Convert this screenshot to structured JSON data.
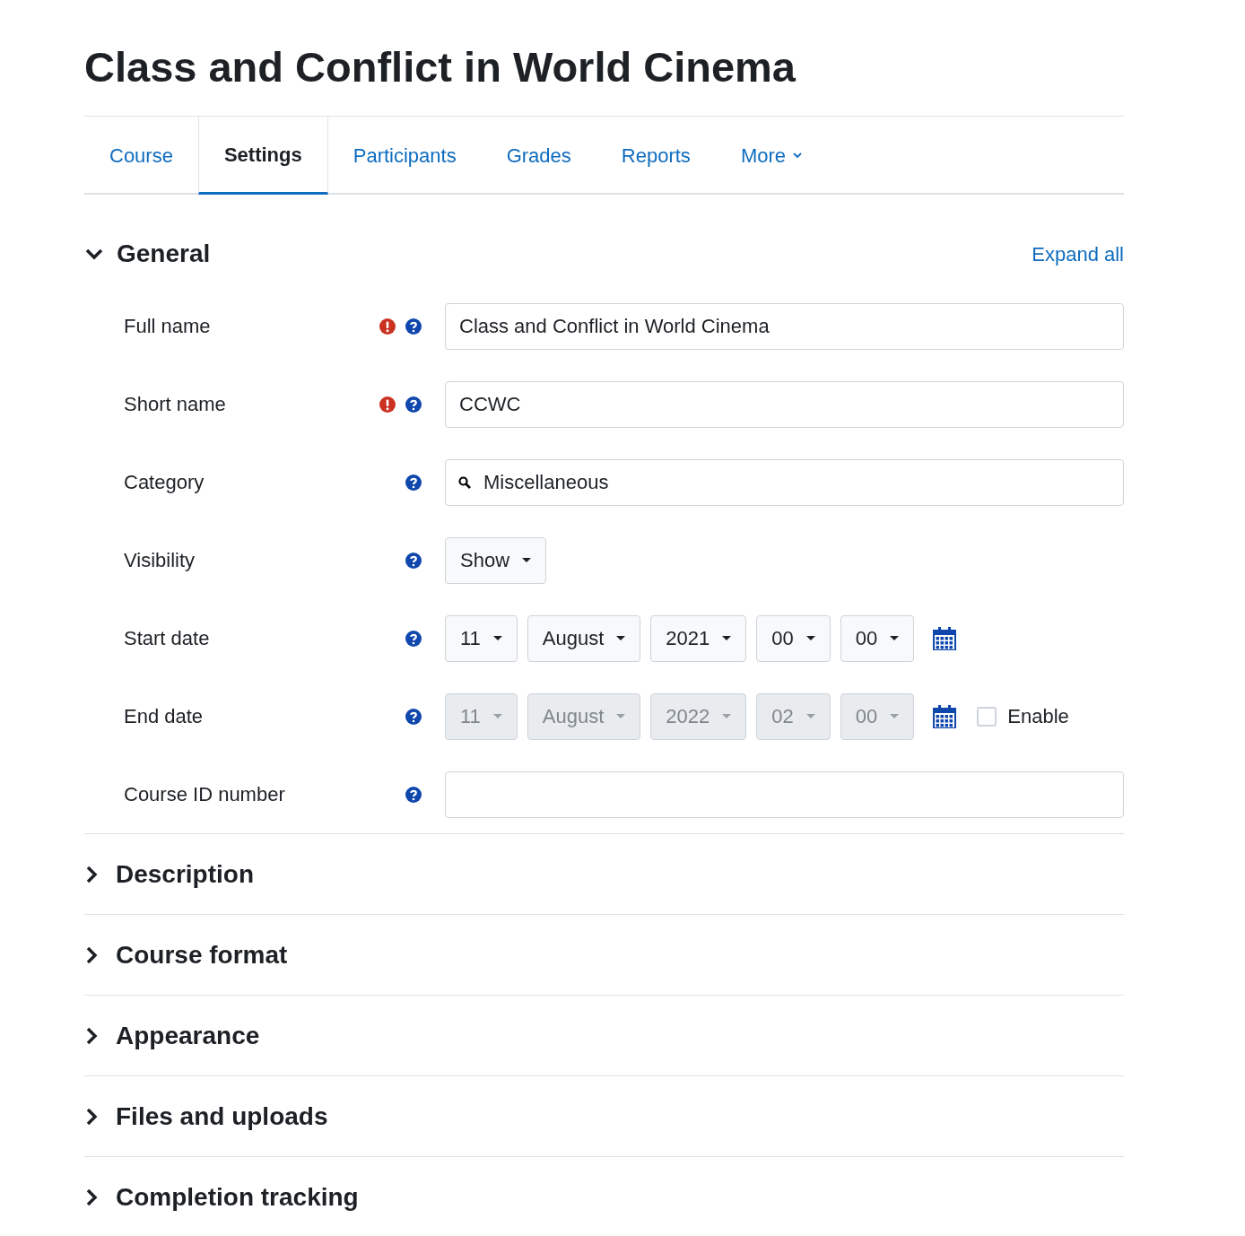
{
  "page_title": "Class and Conflict in World Cinema",
  "tabs": [
    {
      "label": "Course",
      "selected": false,
      "dropdown": false
    },
    {
      "label": "Settings",
      "selected": true,
      "dropdown": false
    },
    {
      "label": "Participants",
      "selected": false,
      "dropdown": false
    },
    {
      "label": "Grades",
      "selected": false,
      "dropdown": false
    },
    {
      "label": "Reports",
      "selected": false,
      "dropdown": false
    },
    {
      "label": "More",
      "selected": false,
      "dropdown": true
    }
  ],
  "general": {
    "title": "General",
    "expanded": true,
    "expand_all": "Expand all",
    "fields": [
      {
        "kind": "text",
        "label": "Full name",
        "required": true,
        "value": "Class and Conflict in World Cinema"
      },
      {
        "kind": "text",
        "label": "Short name",
        "required": true,
        "value": "CCWC"
      },
      {
        "kind": "autocomplete",
        "label": "Category",
        "required": false,
        "value": "Miscellaneous"
      },
      {
        "kind": "select",
        "label": "Visibility",
        "required": false,
        "value": "Show"
      },
      {
        "kind": "date",
        "label": "Start date",
        "required": false,
        "disabled": false,
        "selects": [
          "11",
          "August",
          "2021",
          "00",
          "00"
        ]
      },
      {
        "kind": "date",
        "label": "End date",
        "required": false,
        "disabled": true,
        "selects": [
          "11",
          "August",
          "2022",
          "02",
          "00"
        ],
        "enable": {
          "label": "Enable",
          "checked": false
        }
      },
      {
        "kind": "text",
        "label": "Course ID number",
        "required": false
      }
    ]
  },
  "sections": [
    {
      "title": "Description",
      "expanded": false
    },
    {
      "title": "Course format",
      "expanded": false
    },
    {
      "title": "Appearance",
      "expanded": false
    },
    {
      "title": "Files and uploads",
      "expanded": false
    },
    {
      "title": "Completion tracking",
      "expanded": false
    }
  ]
}
